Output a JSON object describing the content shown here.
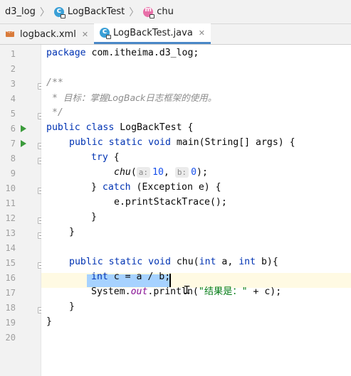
{
  "breadcrumb": {
    "project": "d3_log",
    "class": "LogBackTest",
    "method": "chu"
  },
  "tabs": [
    {
      "label": "logback.xml",
      "icon": "xml-file-icon",
      "active": false
    },
    {
      "label": "LogBackTest.java",
      "icon": "java-class-icon",
      "active": true
    }
  ],
  "line_numbers": [
    "1",
    "2",
    "3",
    "4",
    "5",
    "6",
    "7",
    "8",
    "9",
    "10",
    "11",
    "12",
    "13",
    "14",
    "15",
    "16",
    "17",
    "18",
    "19",
    "20"
  ],
  "code": {
    "l1_kw": "package",
    "l1_rest": " com.itheima.d3_log;",
    "l3": "/**",
    "l4_star": " * ",
    "l4_text": "目标：掌握LogBack日志框架的使用。",
    "l5": " */",
    "l6_kw": "public class",
    "l6_rest": " LogBackTest {",
    "l7_kw": "public static void",
    "l7_rest": " main(String[] args) {",
    "l8_kw": "try",
    "l8_rest": " {",
    "l9_call": "chu",
    "l9_open": "(",
    "l9_hint_a": "a:",
    "l9_val_a": "10",
    "l9_sep": ", ",
    "l9_hint_b": "b:",
    "l9_val_b": "0",
    "l9_close": ");",
    "l10_open": "} ",
    "l10_kw": "catch",
    "l10_rest": " (Exception e) {",
    "l11": "e.printStackTrace();",
    "l12": "}",
    "l13": "}",
    "l15_kw": "public static void",
    "l15_name": " chu(",
    "l15_int1": "int",
    "l15_mid": " a, ",
    "l15_int2": "int",
    "l15_end": " b){",
    "l16_kw": "int",
    "l16_rest": " c = a / b;",
    "l17_a": "System.",
    "l17_out": "out",
    "l17_b": ".println(",
    "l17_str": "\"结果是：\"",
    "l17_c": " + c);",
    "l18": "}",
    "l19": "}"
  },
  "colors": {
    "keyword": "#0033b3",
    "comment": "#8c8c8c",
    "string": "#067d17",
    "number": "#1750eb",
    "field": "#871094",
    "run_icon": "#3b9b3b",
    "selection": "#a6d2ff",
    "active_tab_underline": "#4a88c7"
  }
}
